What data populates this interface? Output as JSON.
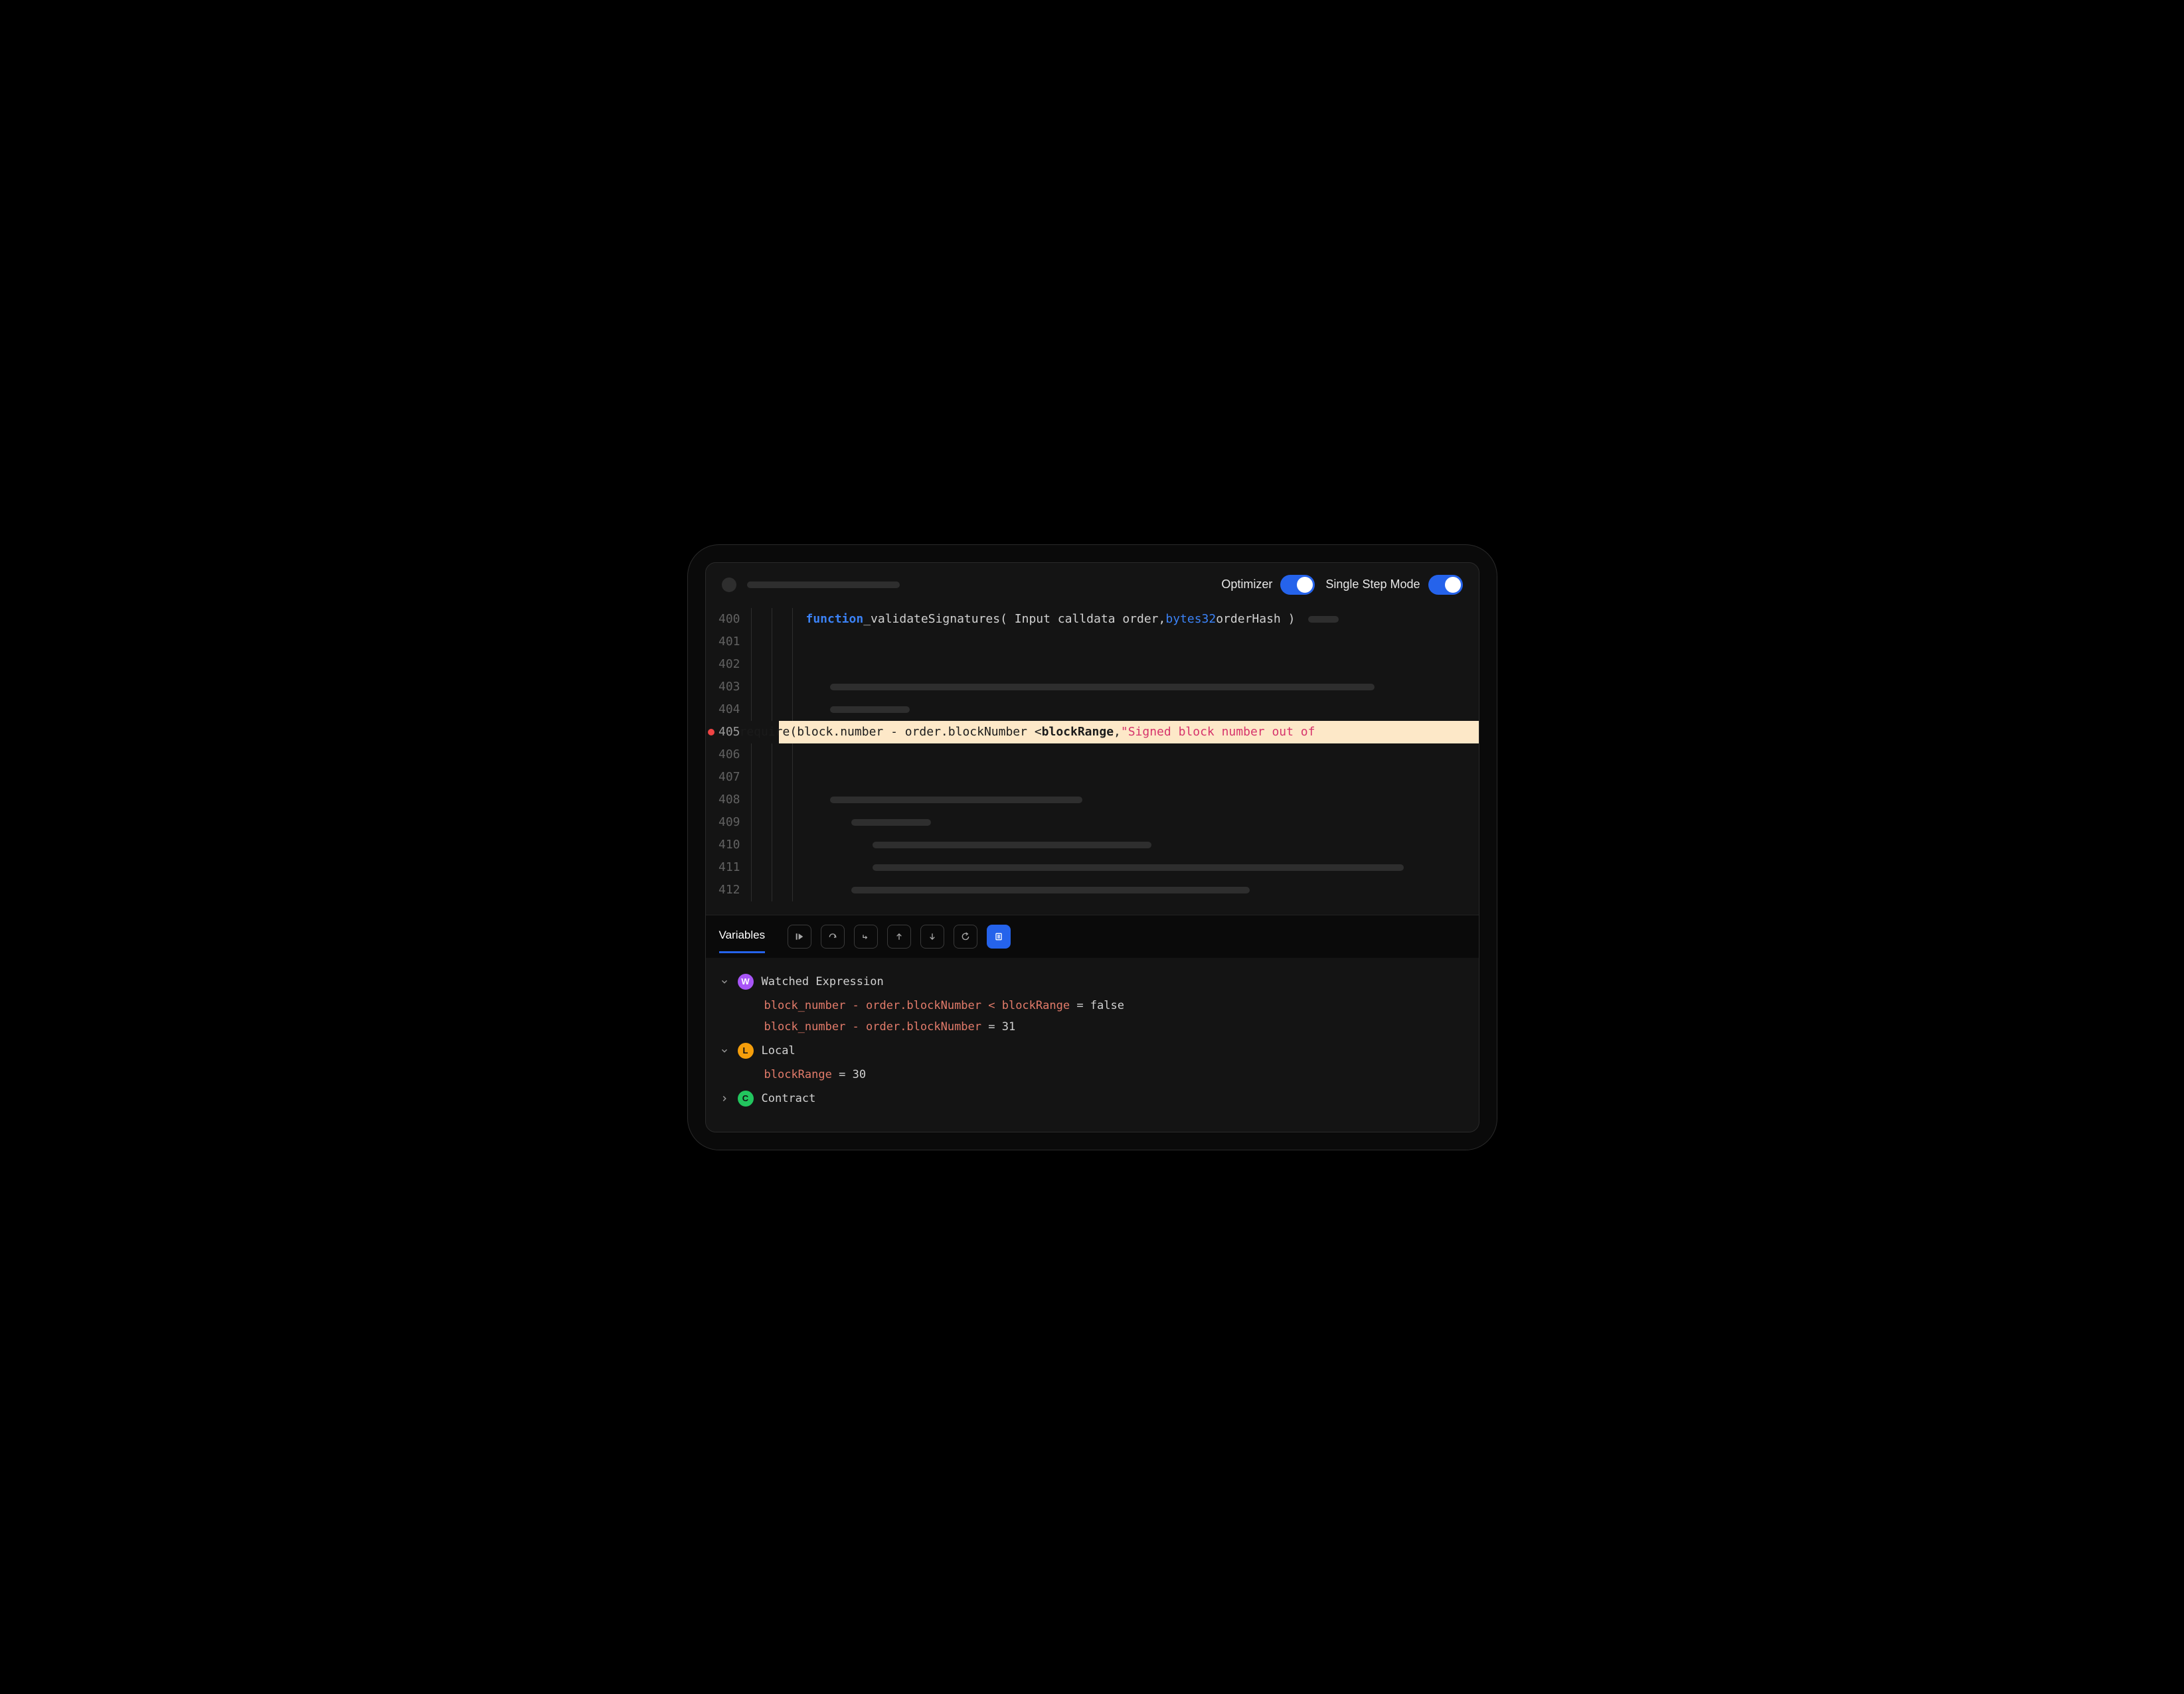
{
  "toggles": {
    "optimizer": {
      "label": "Optimizer",
      "on": true
    },
    "single_step": {
      "label": "Single Step Mode",
      "on": true
    }
  },
  "code": {
    "breakpoint_line": 405,
    "first_line": 400,
    "lines": [
      "400",
      "401",
      "402",
      "403",
      "404",
      "405",
      "406",
      "407",
      "408",
      "409",
      "410",
      "411",
      "412"
    ],
    "sig_kw": "function",
    "sig_name": " _validateSignatures ",
    "sig_params_a": "( Input calldata order, ",
    "sig_type": "bytes32",
    "sig_params_b": " orderHash )",
    "hl_pre": "require(block.number - order.blockNumber < ",
    "hl_bold": "blockRange",
    "hl_mid": ", ",
    "hl_str": "\"Signed block number out of"
  },
  "debugger": {
    "tab": "Variables",
    "scopes": {
      "watched": {
        "badge": "W",
        "label": "Watched Expression",
        "items": [
          {
            "expr": "block_number - order.blockNumber < blockRange",
            "eq": " = ",
            "val": "false"
          },
          {
            "expr": "block_number - order.blockNumber",
            "eq": " = ",
            "val": "31"
          }
        ]
      },
      "local": {
        "badge": "L",
        "label": "Local",
        "items": [
          {
            "expr": "blockRange",
            "eq": " = ",
            "val": "30"
          }
        ]
      },
      "contract": {
        "badge": "C",
        "label": "Contract"
      }
    }
  }
}
